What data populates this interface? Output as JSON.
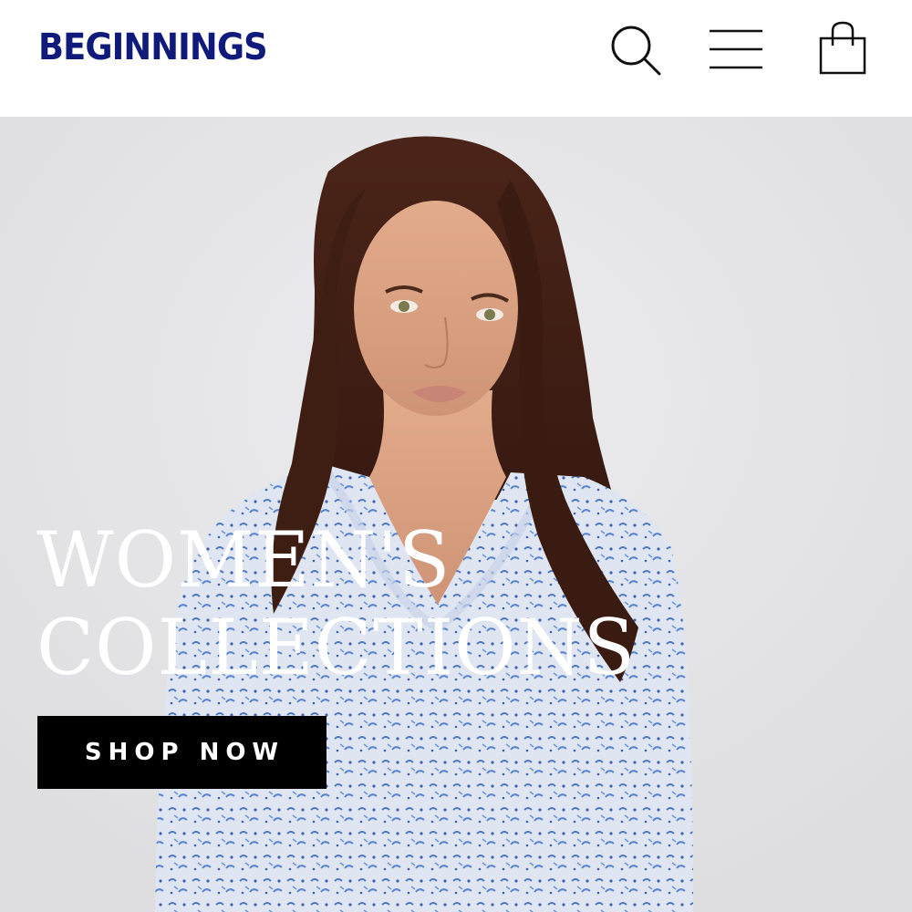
{
  "header": {
    "logo_text": "BEGINNINGS",
    "icons": {
      "search": "search-icon",
      "menu": "hamburger-menu-icon",
      "cart": "shopping-bag-icon"
    }
  },
  "hero": {
    "title_line1": "WOMEN'S",
    "title_line2": "COLLECTIONS",
    "cta_label": "SHOP NOW"
  },
  "colors": {
    "brand": "#101a7a",
    "background": "#e4e4e6",
    "button": "#000000",
    "title": "#ffffff"
  }
}
